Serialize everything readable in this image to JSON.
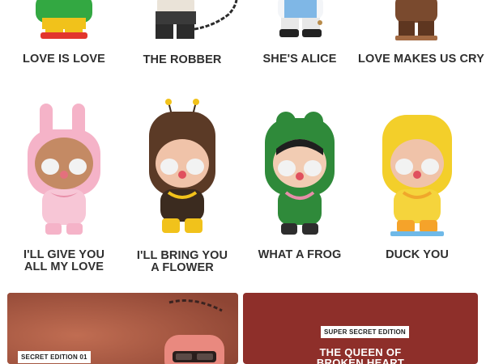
{
  "figures": [
    {
      "name": "LOVE IS LOVE"
    },
    {
      "name": "THE ROBBER"
    },
    {
      "name": "SHE'S ALICE"
    },
    {
      "name": "LOVE MAKES US CRY"
    },
    {
      "name_line1": "I'LL GIVE YOU",
      "name_line2": "ALL MY LOVE"
    },
    {
      "name_line1": "I'LL BRING YOU",
      "name_line2": "A FLOWER"
    },
    {
      "name": "WHAT A FROG"
    },
    {
      "name": "DUCK YOU"
    }
  ],
  "secret_panels": [
    {
      "badge": "SECRET EDITION 01"
    },
    {
      "badge": "SUPER SECRET EDITION",
      "title_line1": "THE QUEEN OF",
      "title_line2": "BROKEN HEART"
    }
  ],
  "colors": {
    "secret_panel_1_bg": "#a3553f",
    "secret_panel_2_bg": "#8e2f2a"
  }
}
